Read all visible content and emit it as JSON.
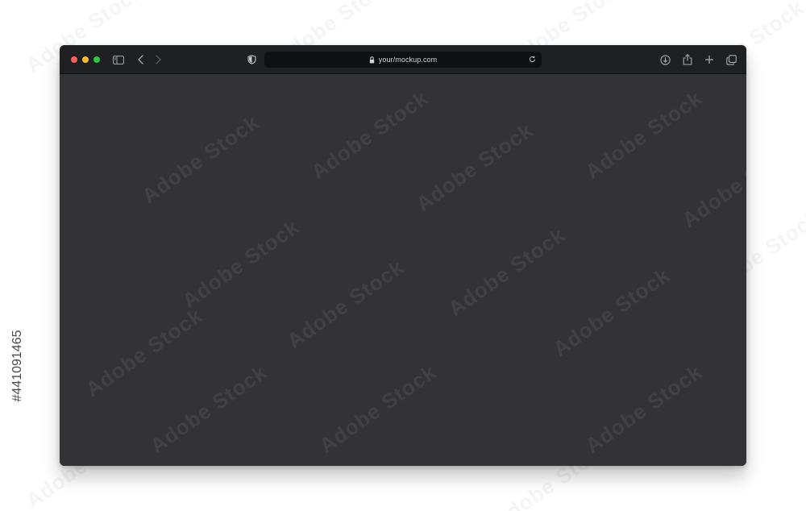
{
  "browser": {
    "url": "your/mockup.com",
    "traffic_lights": {
      "close_color": "#fe5f57",
      "minimize_color": "#febc2e",
      "zoom_color": "#28c840"
    },
    "toolbar_icons": [
      "sidebar-icon",
      "back-icon",
      "forward-icon",
      "shield-icon",
      "lock-icon",
      "reload-icon",
      "download-icon",
      "share-icon",
      "plus-icon",
      "tabs-icon"
    ],
    "toolbar_color": "#1f2022",
    "content_color": "#333336"
  },
  "watermark": {
    "text": "Adobe Stock",
    "id": "#441091465"
  }
}
